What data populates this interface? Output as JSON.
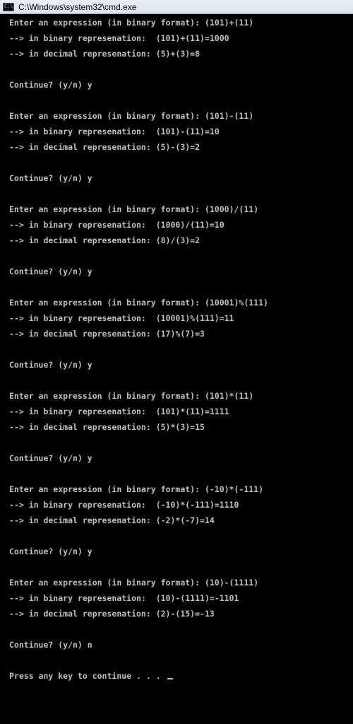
{
  "window": {
    "title": "C:\\Windows\\system32\\cmd.exe",
    "icon": "cmd-icon"
  },
  "console": {
    "lines": [
      "Enter an expression (in binary format): (101)+(11)",
      "--> in binary represenation:  (101)+(11)=1000",
      "--> in decimal represenation: (5)+(3)=8",
      "Continue? (y/n) y",
      "Enter an expression (in binary format): (101)-(11)",
      "--> in binary represenation:  (101)-(11)=10",
      "--> in decimal represenation: (5)-(3)=2",
      "Continue? (y/n) y",
      "Enter an expression (in binary format): (1000)/(11)",
      "--> in binary represenation:  (1000)/(11)=10",
      "--> in decimal represenation: (8)/(3)=2",
      "Continue? (y/n) y",
      "Enter an expression (in binary format): (10001)%(111)",
      "--> in binary represenation:  (10001)%(111)=11",
      "--> in decimal represenation: (17)%(7)=3",
      "Continue? (y/n) y",
      "Enter an expression (in binary format): (101)*(11)",
      "--> in binary represenation:  (101)*(11)=1111",
      "--> in decimal represenation: (5)*(3)=15",
      "Continue? (y/n) y",
      "Enter an expression (in binary format): (-10)*(-111)",
      "--> in binary represenation:  (-10)*(-111)=1110",
      "--> in decimal represenation: (-2)*(-7)=14",
      "Continue? (y/n) y",
      "Enter an expression (in binary format): (10)-(1111)",
      "--> in binary represenation:  (10)-(1111)=-1101",
      "--> in decimal represenation: (2)-(15)=-13",
      "Continue? (y/n) n",
      "Press any key to continue . . . "
    ]
  },
  "colors": {
    "background": "#000000",
    "text": "#c0c0c0"
  }
}
